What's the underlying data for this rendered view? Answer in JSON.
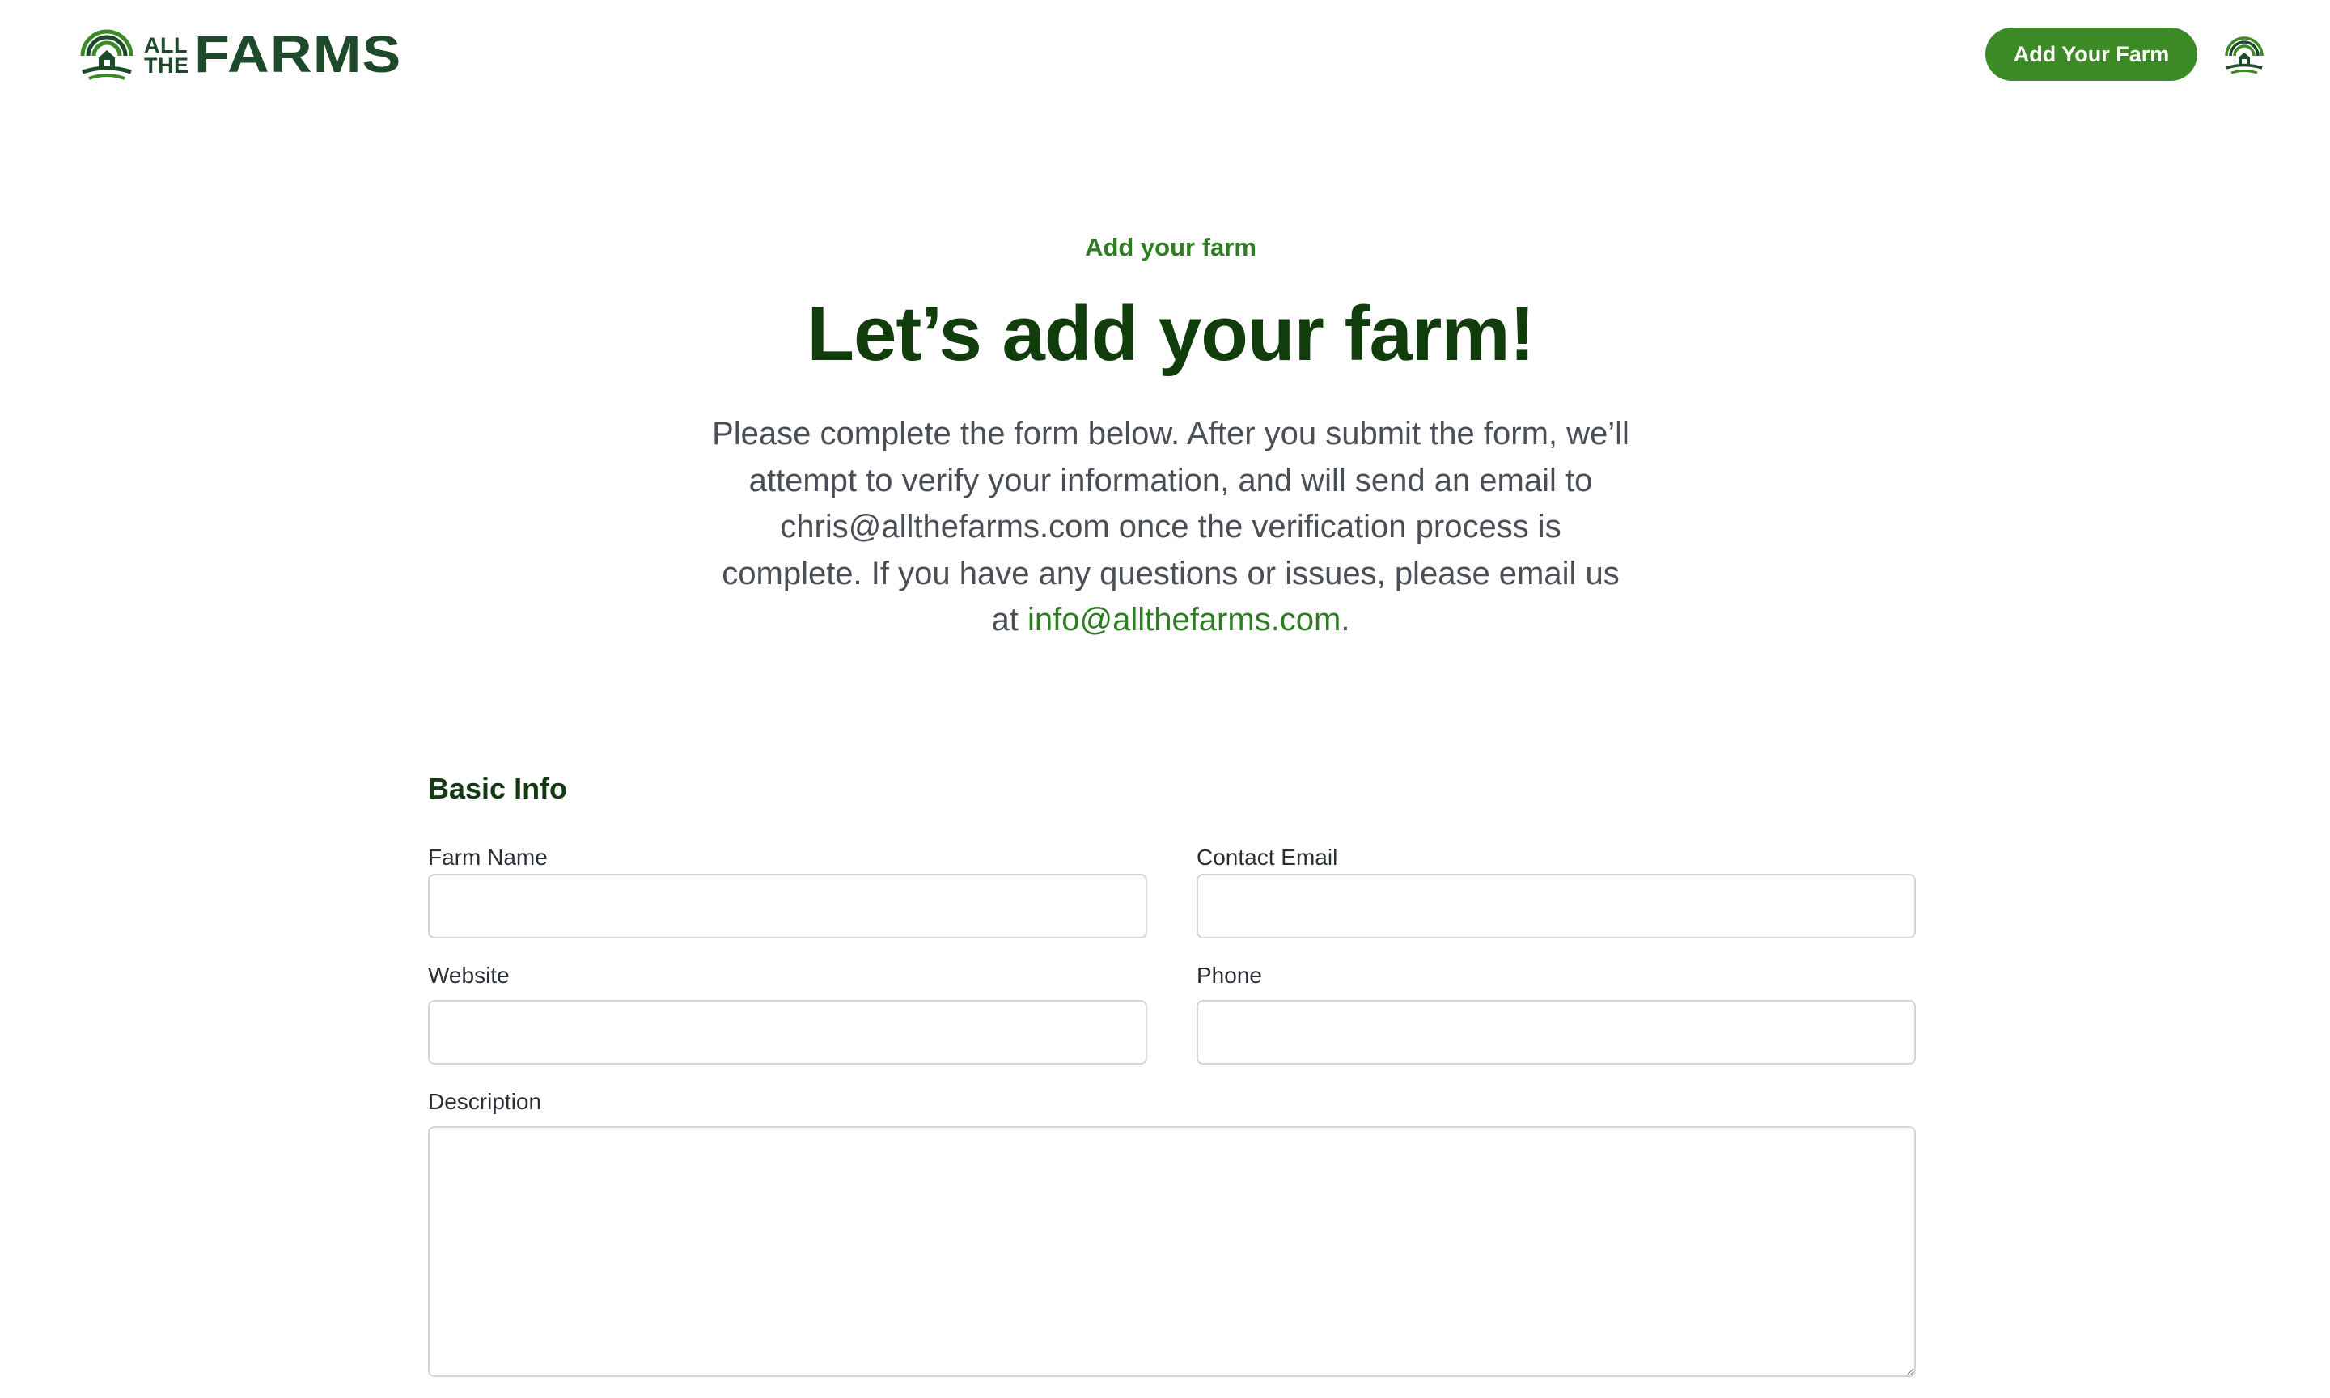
{
  "header": {
    "logo": {
      "small_line_1": "ALL",
      "small_line_2": "THE",
      "big": "FARMS"
    },
    "cta_label": "Add Your Farm",
    "avatar_icon": "barn-logo-icon"
  },
  "hero": {
    "eyebrow": "Add your farm",
    "title": "Let’s add your farm!",
    "intro_text": "Please complete the form below. After you submit the form, we’ll attempt to verify your information, and will send an email to chris@allthefarms.com once the verification process is complete. If you have any questions or issues, please email us at ",
    "intro_link": "info@allthefarms.com",
    "intro_end": "."
  },
  "form": {
    "section_title": "Basic Info",
    "farm_name": {
      "label": "Farm Name",
      "value": ""
    },
    "contact_email": {
      "label": "Contact Email",
      "value": ""
    },
    "website": {
      "label": "Website",
      "value": ""
    },
    "phone": {
      "label": "Phone",
      "value": ""
    },
    "description": {
      "label": "Description",
      "value": ""
    }
  },
  "colors": {
    "brand_green": "#3c8a26",
    "title_green": "#113d0d",
    "logo_green": "#1d4a2b",
    "body_text": "#4a4f57"
  }
}
